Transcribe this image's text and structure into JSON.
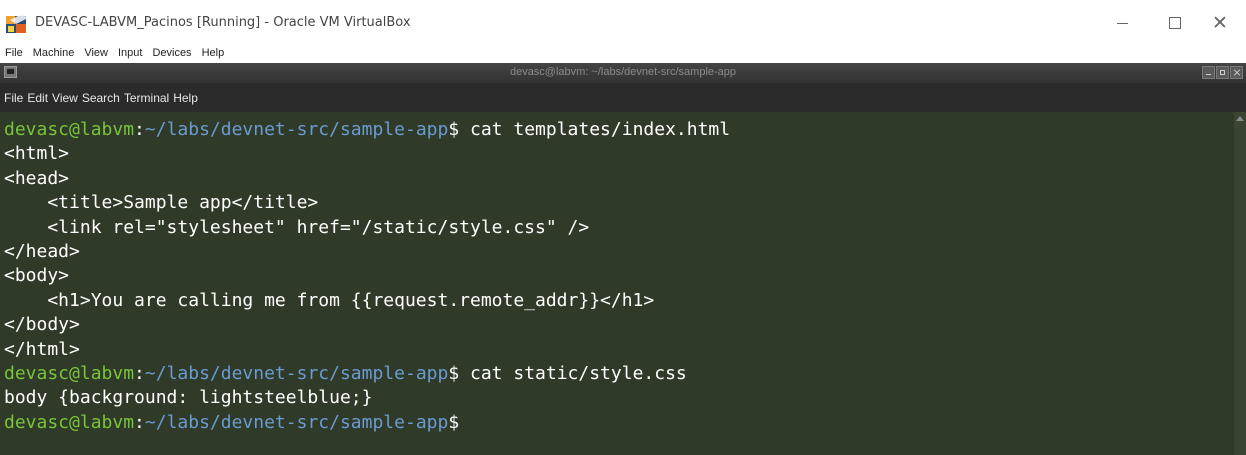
{
  "host_window": {
    "title": "DEVASC-LABVM_Pacinos [Running] - Oracle VM VirtualBox",
    "controls": {
      "minimize": "—",
      "maximize": "☐",
      "close": "✕"
    }
  },
  "vbox_menu": [
    "File",
    "Machine",
    "View",
    "Input",
    "Devices",
    "Help"
  ],
  "terminal_window": {
    "title": "devasc@labvm: ~/labs/devnet-src/sample-app"
  },
  "terminal_menu": [
    "File",
    "Edit",
    "View",
    "Search",
    "Terminal",
    "Help"
  ],
  "terminal": {
    "prompt_user": "devasc@labvm",
    "prompt_sep": ":",
    "prompt_path": "~/labs/devnet-src/sample-app",
    "prompt_dollar": "$",
    "lines": [
      {
        "type": "prompt",
        "command": " cat templates/index.html"
      },
      {
        "type": "output",
        "text": "<html>"
      },
      {
        "type": "output",
        "text": "<head>"
      },
      {
        "type": "output",
        "text": "    <title>Sample app</title>"
      },
      {
        "type": "output",
        "text": "    <link rel=\"stylesheet\" href=\"/static/style.css\" />"
      },
      {
        "type": "output",
        "text": "</head>"
      },
      {
        "type": "output",
        "text": "<body>"
      },
      {
        "type": "output",
        "text": "    <h1>You are calling me from {{request.remote_addr}}</h1>"
      },
      {
        "type": "output",
        "text": "</body>"
      },
      {
        "type": "output",
        "text": "</html>"
      },
      {
        "type": "prompt",
        "command": " cat static/style.css"
      },
      {
        "type": "output",
        "text": "body {background: lightsteelblue;}"
      },
      {
        "type": "prompt",
        "command": ""
      }
    ]
  },
  "colors": {
    "terminal_bg": "#2f3a28",
    "prompt_user": "#78c43a",
    "prompt_path": "#6a9bd1",
    "text": "#ffffff"
  }
}
